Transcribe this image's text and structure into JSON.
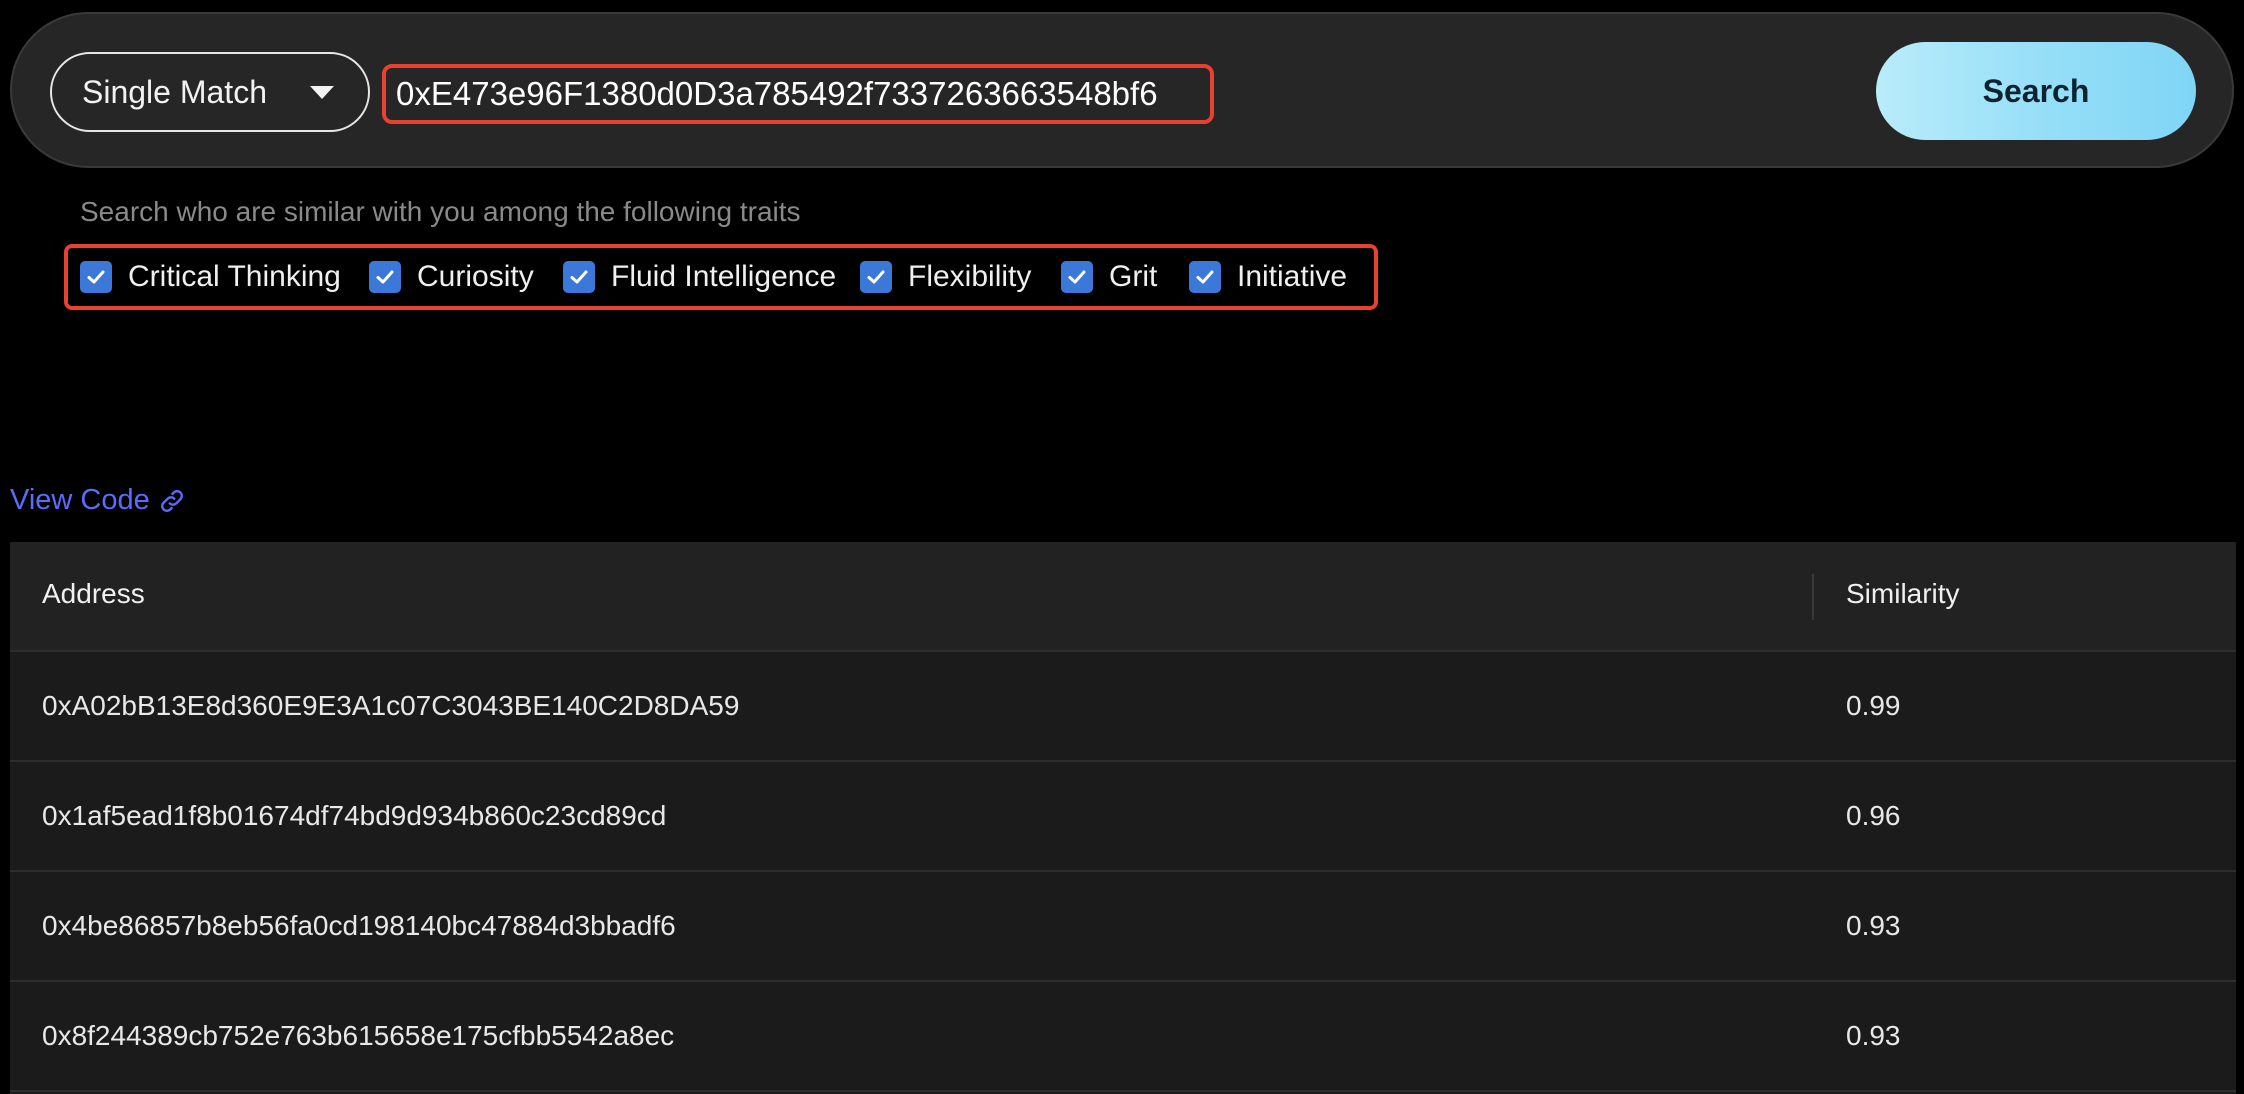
{
  "search": {
    "mode_label": "Single Match",
    "address_value": "0xE473e96F1380d0D3a785492f7337263663548bf6",
    "button_label": "Search"
  },
  "traits": {
    "hint": "Search who are similar with you among the following traits",
    "items": [
      {
        "label": "Critical Thinking",
        "checked": true
      },
      {
        "label": "Curiosity",
        "checked": true
      },
      {
        "label": "Fluid Intelligence",
        "checked": true
      },
      {
        "label": "Flexibility",
        "checked": true
      },
      {
        "label": "Grit",
        "checked": true
      },
      {
        "label": "Initiative",
        "checked": true
      }
    ]
  },
  "view_code": {
    "label": "View Code",
    "icon": "link-icon"
  },
  "table": {
    "headers": {
      "address": "Address",
      "similarity": "Similarity"
    },
    "rows": [
      {
        "address": "0xA02bB13E8d360E9E3A1c07C3043BE140C2D8DA59",
        "similarity": "0.99"
      },
      {
        "address": "0x1af5ead1f8b01674df74bd9d934b860c23cd89cd",
        "similarity": "0.96"
      },
      {
        "address": "0x4be86857b8eb56fa0cd198140bc47884d3bbadf6",
        "similarity": "0.93"
      },
      {
        "address": "0x8f244389cb752e763b615658e175cfbb5542a8ec",
        "similarity": "0.93"
      }
    ]
  },
  "colors": {
    "background": "#000000",
    "search_bar": "#262626",
    "highlight_border": "#e8412f",
    "checkbox": "#3b78d8",
    "link": "#5a6cff",
    "button_gradient_start": "#b9ecfb",
    "button_gradient_end": "#7fd5f6"
  }
}
